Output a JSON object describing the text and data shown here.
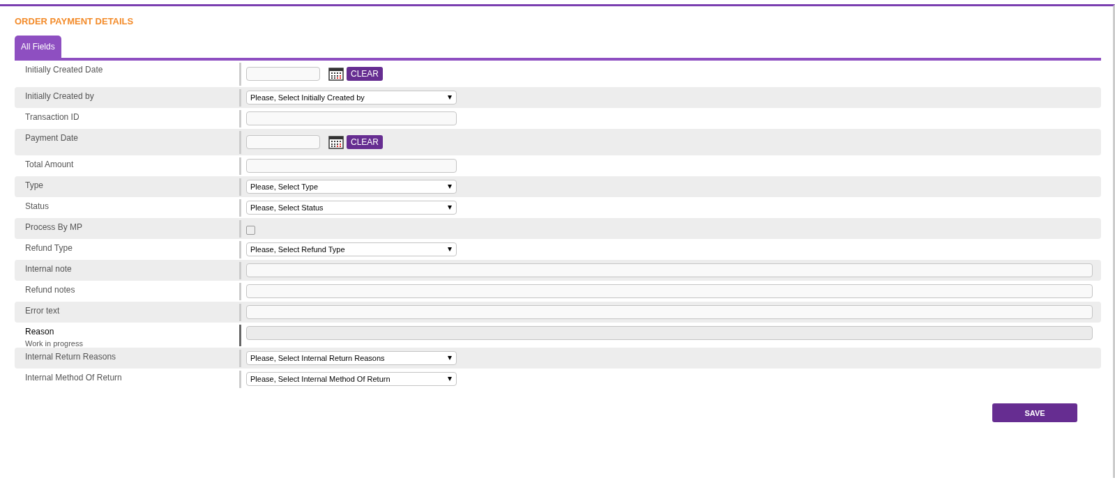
{
  "title": "ORDER PAYMENT DETAILS",
  "tabs": [
    {
      "label": "All Fields",
      "selected": true
    }
  ],
  "fields": [
    {
      "label": "Initially Created Date",
      "kind": "date",
      "button": "CLEAR"
    },
    {
      "label": "Initially Created by",
      "kind": "select",
      "value": "Please, Select Initially Created by"
    },
    {
      "label": "Transaction ID",
      "kind": "text"
    },
    {
      "label": "Payment Date",
      "kind": "date",
      "button": "CLEAR"
    },
    {
      "label": "Total Amount",
      "kind": "text"
    },
    {
      "label": "Type",
      "kind": "select",
      "value": "Please, Select Type"
    },
    {
      "label": "Status",
      "kind": "select",
      "value": "Please, Select Status"
    },
    {
      "label": "Process By MP",
      "kind": "checkbox",
      "checked": false
    },
    {
      "label": "Refund Type",
      "kind": "select",
      "value": "Please, Select Refund Type"
    },
    {
      "label": "Internal note",
      "kind": "wide"
    },
    {
      "label": "Refund notes",
      "kind": "wide"
    },
    {
      "label": "Error text",
      "kind": "wide"
    },
    {
      "label": "Reason",
      "kind": "wide",
      "note": "Work in progress",
      "disabled": true,
      "emphasized": true
    },
    {
      "label": "Internal Return Reasons",
      "kind": "select",
      "value": "Please, Select Internal Return Reasons"
    },
    {
      "label": "Internal Method Of Return",
      "kind": "select",
      "value": "Please, Select Internal Method Of Return"
    }
  ],
  "save_button": "SAVE"
}
